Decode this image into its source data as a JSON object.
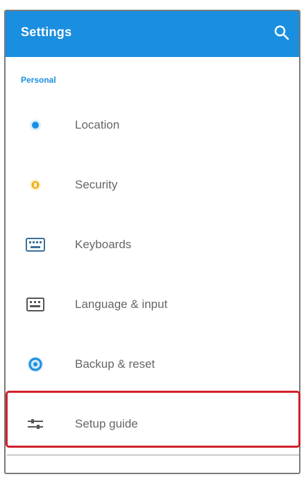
{
  "appbar": {
    "title": "Settings",
    "background_color": "#1a8fe0",
    "search_icon": "search-icon"
  },
  "section": {
    "header": "Personal"
  },
  "items": [
    {
      "label": "Location",
      "icon": "location-icon",
      "icon_color": "#1a8fe0"
    },
    {
      "label": "Security",
      "icon": "security-icon",
      "icon_color": "#f2b21e"
    },
    {
      "label": "Keyboards",
      "icon": "keyboard-icon",
      "icon_color": "#3a6f9a"
    },
    {
      "label": "Language & input",
      "icon": "language-icon",
      "icon_color": "#555555"
    },
    {
      "label": "Backup & reset",
      "icon": "backup-icon",
      "icon_color": "#1a8fe0"
    },
    {
      "label": "Setup guide",
      "icon": "setup-guide-icon",
      "icon_color": "#555555"
    }
  ],
  "highlight_color": "#d0202a"
}
